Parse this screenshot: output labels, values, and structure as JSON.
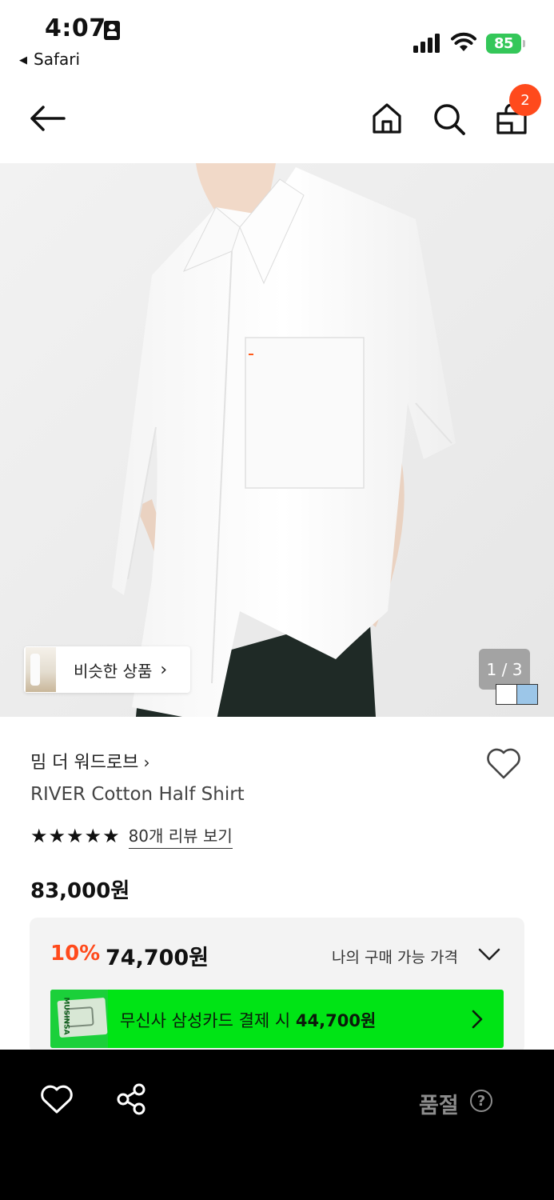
{
  "status_bar": {
    "time": "4:07",
    "back_app": "Safari",
    "battery": "85"
  },
  "nav": {
    "cart_badge": "2",
    "icons": [
      "back-arrow-icon",
      "home-icon",
      "search-icon",
      "cart-icon"
    ]
  },
  "gallery": {
    "similar_label": "비슷한 상품",
    "counter": "1 / 3",
    "color_swatches": [
      "#ffffff",
      "#9cc6e8"
    ]
  },
  "product": {
    "brand": "밈 더 워드로브",
    "name": "RIVER Cotton Half Shirt",
    "stars": "★★★★★",
    "review_link": "80개 리뷰 보기",
    "original_price": "83,000원"
  },
  "price_box": {
    "discount": "10%",
    "sale_price": "74,700원",
    "my_price_label": "나의 구매 가능 가격",
    "card_prefix": "무신사 삼성카드 결제 시 ",
    "card_price": "44,700원",
    "card_image_text": "MUSINSA"
  },
  "bottom_bar": {
    "status": "품절",
    "help": "?"
  },
  "colors": {
    "accent": "#ff4a1c",
    "card_banner": "#00e415",
    "battery": "#34c759"
  }
}
